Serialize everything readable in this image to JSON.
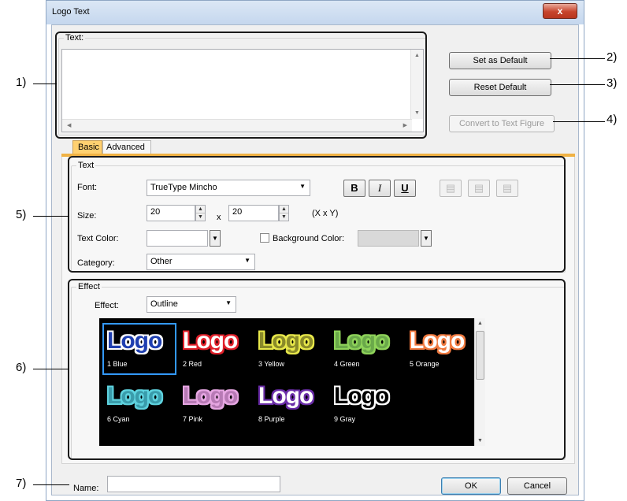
{
  "window": {
    "title": "Logo Text",
    "close_glyph": "x"
  },
  "text_group": {
    "legend": "Text:"
  },
  "right_buttons": {
    "set_default": "Set as Default",
    "reset_default": "Reset Default",
    "convert": "Convert to Text Figure"
  },
  "tabs": [
    {
      "label": "Basic"
    },
    {
      "label": "Advanced"
    }
  ],
  "basic": {
    "text_legend": "Text",
    "font_label": "Font:",
    "font_value": "TrueType Mincho",
    "bold": "B",
    "italic": "I",
    "underline": "U",
    "size_label": "Size:",
    "size_x": "20",
    "size_sep": "x",
    "size_y": "20",
    "size_hint": "(X x Y)",
    "text_color_label": "Text Color:",
    "bg_color_label": "Background Color:",
    "category_label": "Category:",
    "category_value": "Other"
  },
  "effect": {
    "legend": "Effect",
    "label": "Effect:",
    "value": "Outline",
    "items": [
      {
        "word": "Logo",
        "caption": "1 Blue",
        "fill": "#1f3fb0",
        "stroke": "#ffffff"
      },
      {
        "word": "Logo",
        "caption": "2 Red",
        "fill": "#ffffff",
        "stroke": "#e0202a"
      },
      {
        "word": "Logo",
        "caption": "3 Yellow",
        "fill": "#8a8a2a",
        "stroke": "#e8e84a"
      },
      {
        "word": "Logo",
        "caption": "4 Green",
        "fill": "#6aa84a",
        "stroke": "#8fd35a"
      },
      {
        "word": "Logo",
        "caption": "5 Orange",
        "fill": "#ffffff",
        "stroke": "#f07a40"
      },
      {
        "word": "Logo",
        "caption": "6 Cyan",
        "fill": "#3a9cab",
        "stroke": "#5ed2de"
      },
      {
        "word": "Logo",
        "caption": "7 Pink",
        "fill": "#b77ab5",
        "stroke": "#e6a6e2"
      },
      {
        "word": "Logo",
        "caption": "8 Purple",
        "fill": "#ffffff",
        "stroke": "#6a2da8"
      },
      {
        "word": "Logo",
        "caption": "9 Gray",
        "fill": "#000000",
        "stroke": "#ffffff"
      }
    ]
  },
  "footer": {
    "name_label": "Name:",
    "name_value": "",
    "ok": "OK",
    "cancel": "Cancel"
  },
  "annotations": [
    "1)",
    "2)",
    "3)",
    "4)",
    "5)",
    "6)",
    "7)"
  ],
  "colors": {
    "selection": "#3399ff",
    "palette_bg": "#000000"
  }
}
